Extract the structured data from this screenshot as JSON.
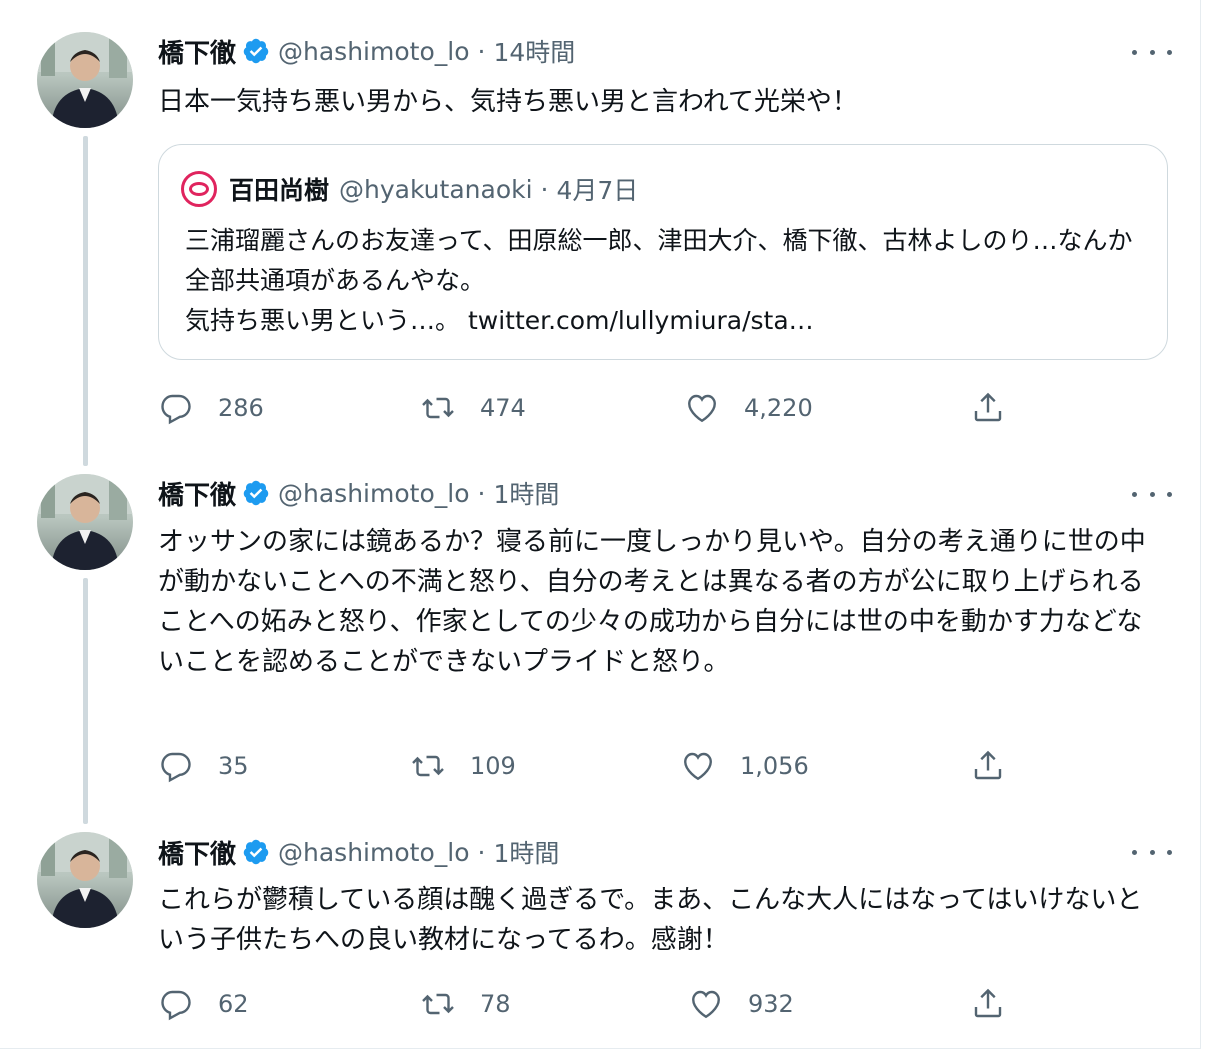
{
  "colors": {
    "verified": "#1d9bf0",
    "secondary_text": "#536471",
    "quote_avatar": "#e0245e"
  },
  "tweets": [
    {
      "name": "橋下徹",
      "handle": "@hashimoto_lo",
      "sep": "·",
      "time": "14時間",
      "text": "日本一気持ち悪い男から、気持ち悪い男と言われて光栄や！",
      "quote": {
        "name": "百田尚樹",
        "handle": "@hyakutanaoki",
        "sep": "·",
        "time": "4月7日",
        "text": "三浦瑠麗さんのお友達って、田原総一郎、津田大介、橋下徹、古林よしのり…なんか全部共通項があるんやな。\n気持ち悪い男という…。 twitter.com/lullymiura/sta…"
      },
      "replies": "286",
      "retweets": "474",
      "likes": "4,220"
    },
    {
      "name": "橋下徹",
      "handle": "@hashimoto_lo",
      "sep": "·",
      "time": "1時間",
      "text": "オッサンの家には鏡あるか？寝る前に一度しっかり見いや。自分の考え通りに世の中が動かないことへの不満と怒り、自分の考えとは異なる者の方が公に取り上げられることへの妬みと怒り、作家としての少々の成功から自分には世の中を動かす力などないことを認めることができないプライドと怒り。",
      "replies": "35",
      "retweets": "109",
      "likes": "1,056"
    },
    {
      "name": "橋下徹",
      "handle": "@hashimoto_lo",
      "sep": "·",
      "time": "1時間",
      "text": "これらが鬱積している顔は醜く過ぎるで。まあ、こんな大人にはなってはいけないという子供たちへの良い教材になってるわ。感謝！",
      "replies": "62",
      "retweets": "78",
      "likes": "932"
    }
  ],
  "icons": [
    "verified-badge-icon",
    "more-icon",
    "reply-icon",
    "retweet-icon",
    "like-icon",
    "share-icon"
  ]
}
